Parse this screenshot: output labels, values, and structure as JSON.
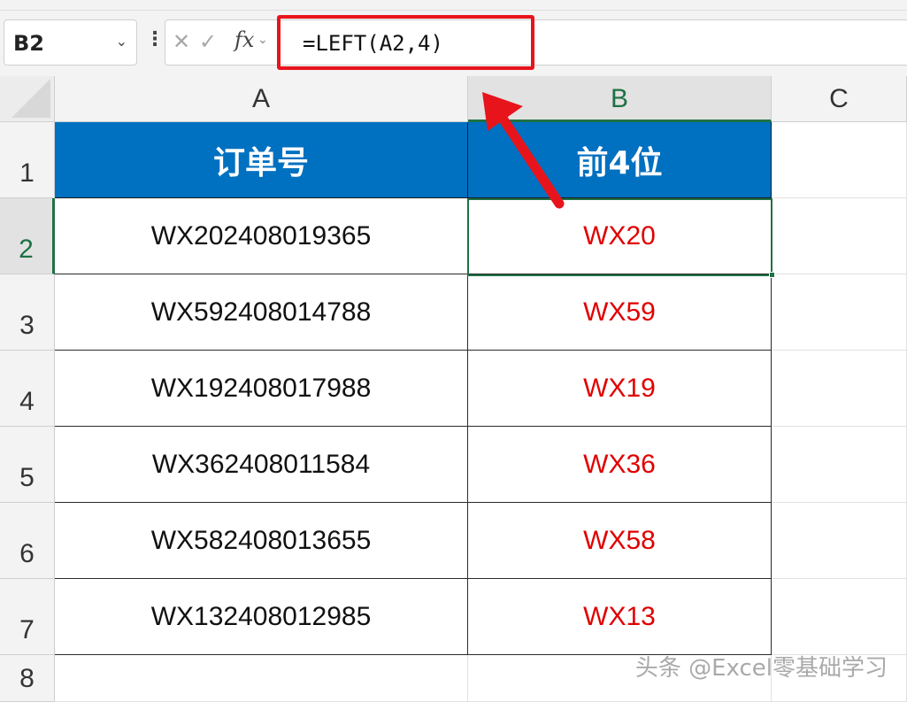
{
  "name_box": {
    "value": "B2"
  },
  "formula_bar": {
    "cancel_glyph": "✕",
    "enter_glyph": "✓",
    "fx_label": "fx",
    "formula": "=LEFT(A2,4)"
  },
  "columns": [
    "A",
    "B",
    "C"
  ],
  "rows": [
    "1",
    "2",
    "3",
    "4",
    "5",
    "6",
    "7",
    "8"
  ],
  "table": {
    "headers": [
      "订单号",
      "前4位"
    ],
    "rows": [
      [
        "WX202408019365",
        "WX20"
      ],
      [
        "WX592408014788",
        "WX59"
      ],
      [
        "WX192408017988",
        "WX19"
      ],
      [
        "WX362408011584",
        "WX36"
      ],
      [
        "WX582408013655",
        "WX58"
      ],
      [
        "WX132408012985",
        "WX13"
      ]
    ]
  },
  "selected_cell": "B2",
  "watermark": "头条 @Excel零基础学习",
  "colors": {
    "header_fill": "#0070c0",
    "result_text": "#e00000",
    "selection": "#1e7145",
    "highlight": "#e8141c"
  }
}
